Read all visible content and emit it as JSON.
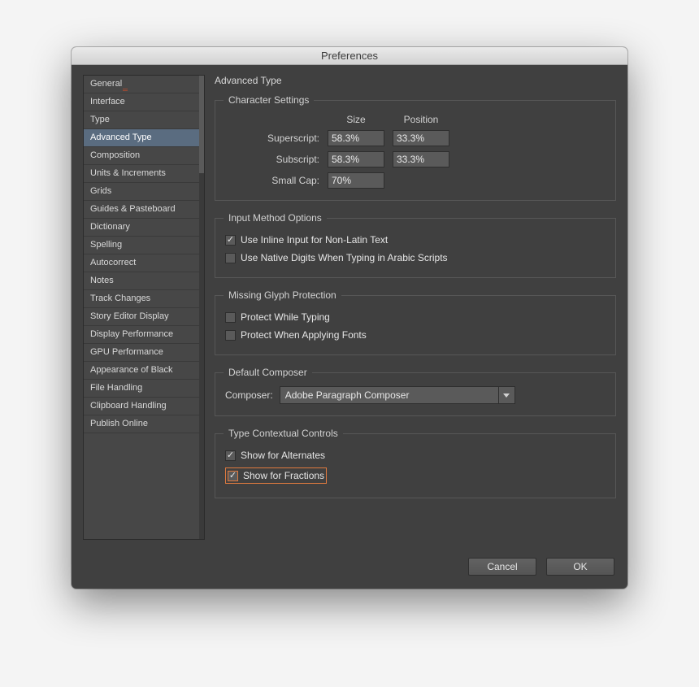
{
  "window": {
    "title": "Preferences"
  },
  "sidebar": {
    "items": [
      {
        "label": "General",
        "marked": true
      },
      {
        "label": "Interface"
      },
      {
        "label": "Type"
      },
      {
        "label": "Advanced Type",
        "selected": true
      },
      {
        "label": "Composition"
      },
      {
        "label": "Units & Increments"
      },
      {
        "label": "Grids"
      },
      {
        "label": "Guides & Pasteboard"
      },
      {
        "label": "Dictionary"
      },
      {
        "label": "Spelling"
      },
      {
        "label": "Autocorrect"
      },
      {
        "label": "Notes"
      },
      {
        "label": "Track Changes"
      },
      {
        "label": "Story Editor Display"
      },
      {
        "label": "Display Performance"
      },
      {
        "label": "GPU Performance"
      },
      {
        "label": "Appearance of Black"
      },
      {
        "label": "File Handling"
      },
      {
        "label": "Clipboard Handling"
      },
      {
        "label": "Publish Online"
      }
    ]
  },
  "main": {
    "title": "Advanced Type",
    "character_settings": {
      "legend": "Character Settings",
      "size_header": "Size",
      "position_header": "Position",
      "superscript_label": "Superscript:",
      "superscript_size": "58.3%",
      "superscript_position": "33.3%",
      "subscript_label": "Subscript:",
      "subscript_size": "58.3%",
      "subscript_position": "33.3%",
      "smallcap_label": "Small Cap:",
      "smallcap_size": "70%"
    },
    "input_method": {
      "legend": "Input Method Options",
      "inline_input_label": "Use Inline Input for Non-Latin Text",
      "inline_input_checked": true,
      "native_digits_label": "Use Native Digits When Typing in Arabic Scripts",
      "native_digits_checked": false
    },
    "glyph_protection": {
      "legend": "Missing Glyph Protection",
      "protect_typing_label": "Protect While Typing",
      "protect_typing_checked": false,
      "protect_fonts_label": "Protect When Applying Fonts",
      "protect_fonts_checked": false
    },
    "default_composer": {
      "legend": "Default Composer",
      "label": "Composer:",
      "value": "Adobe Paragraph Composer"
    },
    "contextual_controls": {
      "legend": "Type Contextual Controls",
      "alternates_label": "Show for Alternates",
      "alternates_checked": true,
      "fractions_label": "Show for Fractions",
      "fractions_checked": true,
      "fractions_highlighted": true
    }
  },
  "footer": {
    "cancel": "Cancel",
    "ok": "OK"
  }
}
